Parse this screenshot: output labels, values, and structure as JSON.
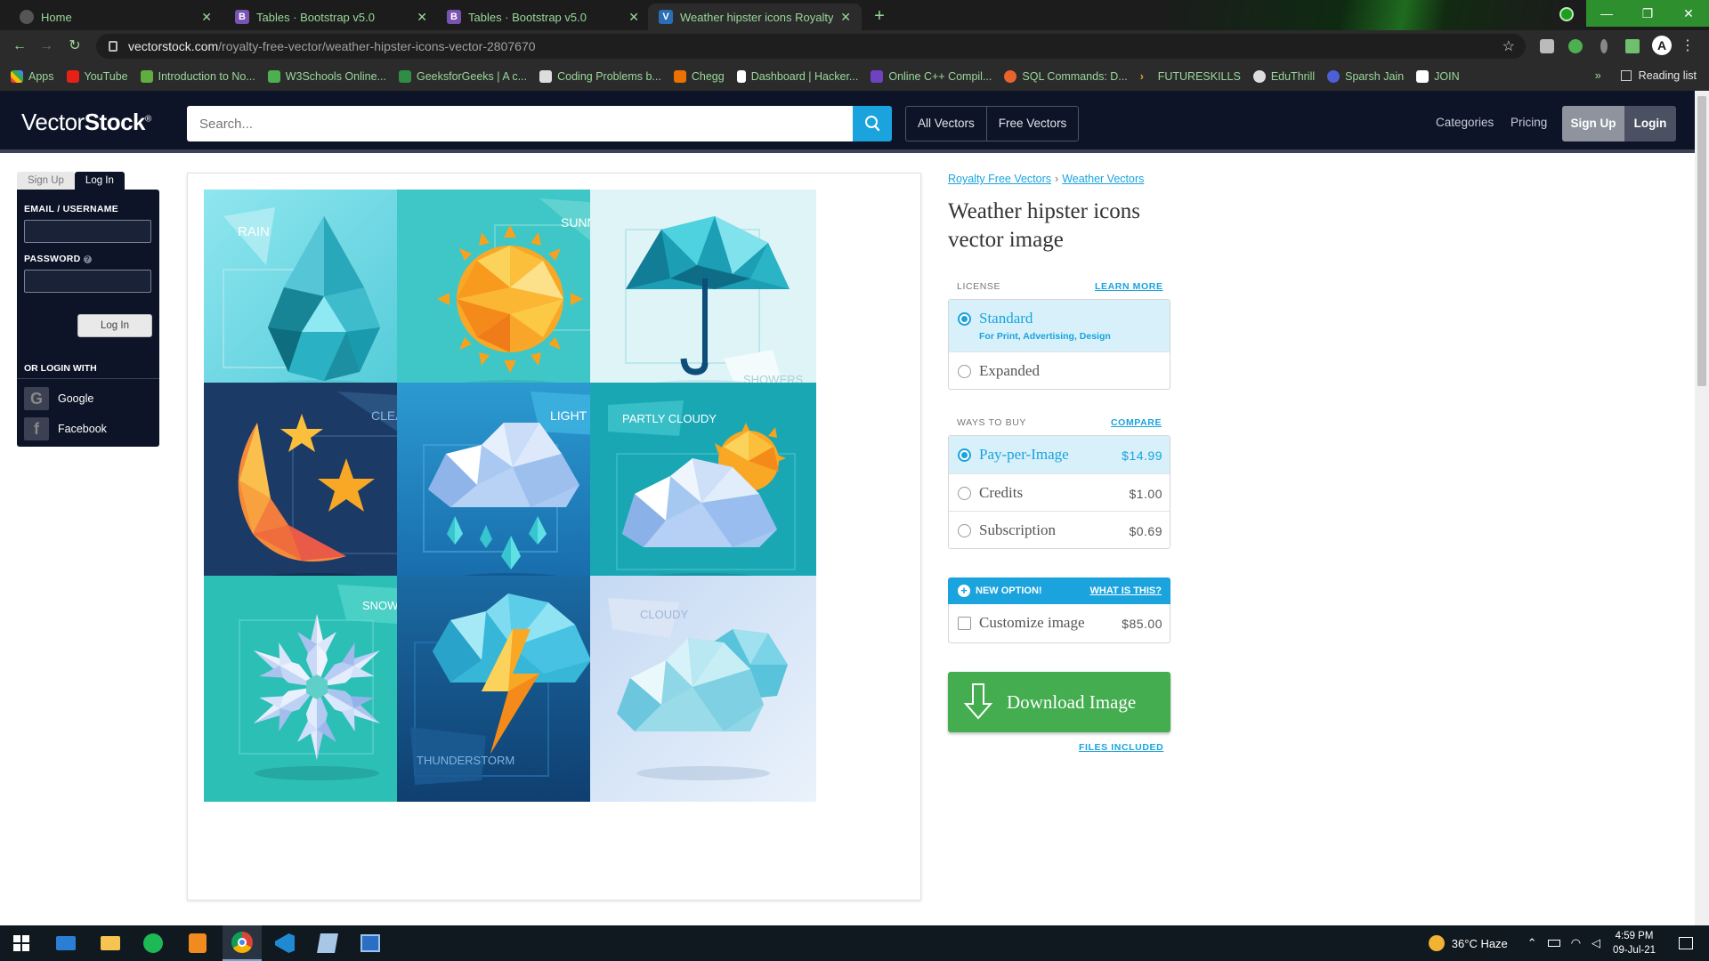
{
  "browser": {
    "tabs": [
      {
        "label": "Home",
        "active": false,
        "favicon_color": "#555555",
        "favicon": ""
      },
      {
        "label": "Tables · Bootstrap v5.0",
        "active": false,
        "favicon_color": "#7952b3",
        "favicon": "B"
      },
      {
        "label": "Tables · Bootstrap v5.0",
        "active": false,
        "favicon_color": "#7952b3",
        "favicon": "B"
      },
      {
        "label": "Weather hipster icons Royalty Fre",
        "active": true,
        "favicon_color": "#2a6fb5",
        "favicon": "V"
      }
    ],
    "url_host": "vectorstock.com",
    "url_path": "/royalty-free-vector/weather-hipster-icons-vector-2807670",
    "bookmarks": [
      {
        "label": "Apps",
        "color": "#e8a33a"
      },
      {
        "label": "YouTube",
        "color": "#e62117"
      },
      {
        "label": "Introduction to No...",
        "color": "#5fae3f"
      },
      {
        "label": "W3Schools Online...",
        "color": "#4caf50"
      },
      {
        "label": "GeeksforGeeks | A c...",
        "color": "#2f8d46"
      },
      {
        "label": "Coding Problems b...",
        "color": "#dddddd"
      },
      {
        "label": "Chegg",
        "color": "#eb7100"
      },
      {
        "label": "Dashboard | Hacker...",
        "color": "#ffffff"
      },
      {
        "label": "Online C++ Compil...",
        "color": "#6f42c1"
      },
      {
        "label": "SQL Commands: D...",
        "color": "#e8642c"
      },
      {
        "label": "FUTURESKILLS",
        "color": "#d9a626"
      },
      {
        "label": "EduThrill",
        "color": "#dddddd"
      },
      {
        "label": "Sparsh Jain",
        "color": "#4e5fd6"
      },
      {
        "label": "JOIN",
        "color": "#ffffff"
      }
    ],
    "reading_list": "Reading list",
    "overflow": "»"
  },
  "site": {
    "logo_vector": "Vector",
    "logo_stock": "Stock",
    "logo_reg": "®",
    "search_placeholder": "Search...",
    "filter_all": "All Vectors",
    "filter_free": "Free Vectors",
    "nav_categories": "Categories",
    "nav_pricing": "Pricing",
    "signup": "Sign Up",
    "login": "Login"
  },
  "login_panel": {
    "tab_signup": "Sign Up",
    "tab_login": "Log In",
    "email_label": "EMAIL / USERNAME",
    "password_label": "PASSWORD",
    "login_button": "Log In",
    "or_login_with": "OR LOGIN WITH",
    "google": "Google",
    "facebook": "Facebook"
  },
  "tiles": [
    {
      "label": "RAIN",
      "subject": "raindrop",
      "bg": "#6fd6e2"
    },
    {
      "label": "SUNNY",
      "subject": "sun",
      "bg": "#3fc6c6"
    },
    {
      "label": "SHOWERS",
      "subject": "umbrella",
      "bg": "#d8f2f6"
    },
    {
      "label": "CLEAR",
      "subject": "moon-stars",
      "bg": "#1c3a66"
    },
    {
      "label": "LIGHT RAIN",
      "subject": "cloud-rain",
      "bg": "#1f7fc0"
    },
    {
      "label": "PARTLY CLOUDY",
      "subject": "cloud-sun",
      "bg": "#1aa7b4"
    },
    {
      "label": "SNOWFALL",
      "subject": "snowflake",
      "bg": "#2cbfb6"
    },
    {
      "label": "THUNDERSTORM",
      "subject": "cloud-lightning",
      "bg": "#1a5f94"
    },
    {
      "label": "CLOUDY",
      "subject": "clouds",
      "bg": "#cfe0f4"
    }
  ],
  "product": {
    "crumb_1": "Royalty Free Vectors",
    "crumb_sep": "›",
    "crumb_2": "Weather Vectors",
    "title": "Weather hipster icons vector image",
    "license_head": "LICENSE",
    "learn_more": "LEARN MORE",
    "license_options": [
      {
        "name": "Standard",
        "sub": "For Print, Advertising, Design",
        "selected": true
      },
      {
        "name": "Expanded",
        "sub": "",
        "selected": false
      }
    ],
    "ways_head": "WAYS TO BUY",
    "compare": "COMPARE",
    "buy_options": [
      {
        "name": "Pay-per-Image",
        "price": "$14.99",
        "selected": true
      },
      {
        "name": "Credits",
        "price": "$1.00",
        "selected": false
      },
      {
        "name": "Subscription",
        "price": "$0.69",
        "selected": false
      }
    ],
    "new_option": "NEW OPTION!",
    "what_is_this": "WHAT IS THIS?",
    "customize": "Customize image",
    "customize_price": "$85.00",
    "download": "Download Image",
    "files_included": "FILES INCLUDED"
  },
  "taskbar": {
    "weather": "36°C  Haze",
    "time": "4:59 PM",
    "date": "09-Jul-21"
  }
}
